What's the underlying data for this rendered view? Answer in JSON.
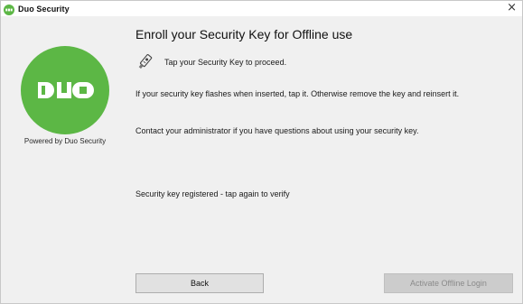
{
  "window": {
    "title": "Duo Security",
    "close_glyph": "×"
  },
  "branding": {
    "logo_text": "DUO",
    "logo_color": "#5cb745",
    "powered_by": "Powered by Duo Security"
  },
  "content": {
    "heading": "Enroll your Security Key for Offline use",
    "tap_instruction": "Tap your Security Key to proceed.",
    "paragraph1": "If your security key flashes when inserted, tap it. Otherwise remove the key and reinsert it.",
    "paragraph2": "Contact your administrator if you have questions about using your security key.",
    "status": "Security key registered - tap again to verify"
  },
  "buttons": {
    "back_label": "Back",
    "activate_label": "Activate Offline Login",
    "activate_enabled": false
  },
  "icons": {
    "app": "duo-app-icon",
    "key": "security-key-icon",
    "close": "close-icon"
  }
}
